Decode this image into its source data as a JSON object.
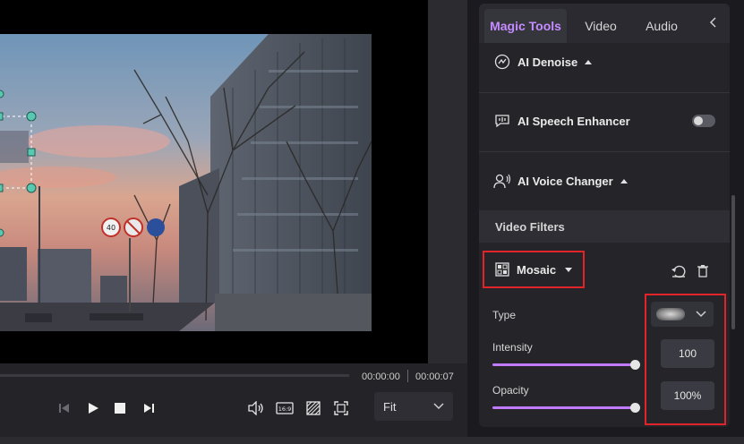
{
  "player": {
    "time_current": "00:00:00",
    "time_total": "00:00:07",
    "fit_label": "Fit",
    "aspect_label": "16:9",
    "sign_label": "40"
  },
  "tabs": [
    {
      "label": "Magic Tools",
      "active": true
    },
    {
      "label": "Video"
    },
    {
      "label": "Audio"
    }
  ],
  "tools": {
    "denoise_label": "AI Denoise",
    "speech_label": "AI Speech Enhancer",
    "speech_enabled": false,
    "voice_label": "AI Voice Changer"
  },
  "filters": {
    "header": "Video Filters",
    "name": "Mosaic",
    "type_label": "Type",
    "intensity_label": "Intensity",
    "intensity_value": "100",
    "opacity_label": "Opacity",
    "opacity_value": "100%"
  },
  "colors": {
    "accent": "#c48cff",
    "highlight": "#e0242a",
    "slider": "#c07bff"
  }
}
